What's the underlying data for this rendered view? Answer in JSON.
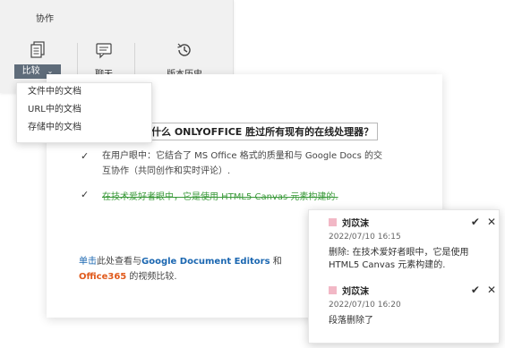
{
  "ribbon": {
    "tab_label": "协作",
    "compare_label": "比较",
    "chat_label": "聊天",
    "history_label": "版本历史"
  },
  "dropdown": {
    "items": [
      "文件中的文档",
      "URL中的文档",
      "存储中的文档"
    ]
  },
  "document": {
    "title": "什么 ONLYOFFICE 胜过所有现有的在线处理器？",
    "bullet1": "在用户眼中：它结合了 MS Office 格式的质量和与 Google Docs 的交互协作（共同创作和实时评论）.",
    "bullet2": "在技术爱好者眼中，它是使用 HTML5 Canvas 元素构建的.",
    "link_word": "单击",
    "link_text1": "此处查看与",
    "google": "Google Document Editors",
    "and": " 和",
    "office": "Office365",
    "link_text2": " 的视频比较."
  },
  "comments": [
    {
      "author": "刘苡沫",
      "date": "2022/07/10  16:15",
      "text": "删除: 在技术爱好者眼中，它是使用 HTML5 Canvas 元素构建的."
    },
    {
      "author": "刘苡沫",
      "date": "2022/07/10  16:20",
      "text": "段落删除了"
    }
  ],
  "colors": {
    "accent_green": "#3b9a3b",
    "link_blue": "#1b67b1",
    "office_orange": "#e05a1c",
    "author_swatch": "#f2b8c6"
  },
  "icons": [
    "compare-icon",
    "chevron-down-icon",
    "chat-icon",
    "history-icon",
    "check-icon",
    "close-icon"
  ]
}
